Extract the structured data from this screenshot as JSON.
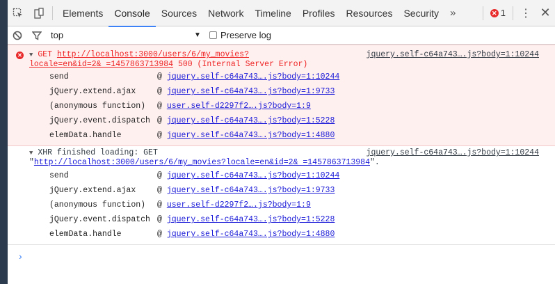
{
  "tabs": {
    "items": [
      "Elements",
      "Console",
      "Sources",
      "Network",
      "Timeline",
      "Profiles",
      "Resources",
      "Security"
    ],
    "overflow": "»",
    "error_count": "1"
  },
  "filter": {
    "context": "top",
    "preserve_log": "Preserve log"
  },
  "error_msg": {
    "method": "GET",
    "url_line1": "http://localhost:3000/users/6/my_movies?",
    "url_line2": "locale=en&id=2& =1457863713984",
    "status": "500 (Internal Server Error)",
    "source": "jquery.self-c64a743….js?body=1:10244",
    "stack": [
      {
        "fn": "send",
        "src": "jquery.self-c64a743….js?body=1:10244"
      },
      {
        "fn": "jQuery.extend.ajax",
        "src": "jquery.self-c64a743….js?body=1:9733"
      },
      {
        "fn": "(anonymous function)",
        "src": "user.self-d2297f2….js?body=1:9"
      },
      {
        "fn": "jQuery.event.dispatch",
        "src": "jquery.self-c64a743….js?body=1:5228"
      },
      {
        "fn": "elemData.handle",
        "src": "jquery.self-c64a743….js?body=1:4880"
      }
    ]
  },
  "xhr_msg": {
    "text": "XHR finished loading: GET",
    "url_open_quote": "\"",
    "url": "http://localhost:3000/users/6/my_movies?locale=en&id=2& =1457863713984",
    "url_close": "\".",
    "source": "jquery.self-c64a743….js?body=1:10244",
    "stack": [
      {
        "fn": "send",
        "src": "jquery.self-c64a743….js?body=1:10244"
      },
      {
        "fn": "jQuery.extend.ajax",
        "src": "jquery.self-c64a743….js?body=1:9733"
      },
      {
        "fn": "(anonymous function)",
        "src": "user.self-d2297f2….js?body=1:9"
      },
      {
        "fn": "jQuery.event.dispatch",
        "src": "jquery.self-c64a743….js?body=1:5228"
      },
      {
        "fn": "elemData.handle",
        "src": "jquery.self-c64a743….js?body=1:4880"
      }
    ]
  },
  "at_sign": "@",
  "prompt": "›"
}
